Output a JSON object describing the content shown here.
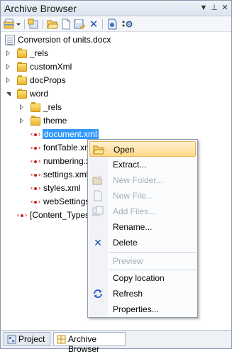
{
  "window": {
    "title": "Archive Browser",
    "buttons": {
      "dropdown": "▼",
      "pin": "⊥",
      "close": "✕"
    }
  },
  "toolbar": {
    "icons": [
      "new-archive-icon",
      "dropdown-arrow-icon",
      "add-icon",
      "open-folder-icon",
      "new-file-icon",
      "save-icon",
      "delete-icon",
      "document-icon",
      "settings-icon"
    ]
  },
  "tree": {
    "root": "Conversion of units.docx",
    "items": [
      {
        "label": "_rels",
        "type": "folder"
      },
      {
        "label": "customXml",
        "type": "folder"
      },
      {
        "label": "docProps",
        "type": "folder"
      },
      {
        "label": "word",
        "type": "folder"
      },
      {
        "label": "_rels",
        "type": "folder"
      },
      {
        "label": "theme",
        "type": "folder"
      },
      {
        "label": "document.xml",
        "type": "xml"
      },
      {
        "label": "fontTable.xml",
        "type": "xml"
      },
      {
        "label": "numbering.xml",
        "type": "xml"
      },
      {
        "label": "settings.xml",
        "type": "xml"
      },
      {
        "label": "styles.xml",
        "type": "xml"
      },
      {
        "label": "webSettings.xml",
        "type": "xml"
      },
      {
        "label": "[Content_Types].xml",
        "type": "xml"
      }
    ]
  },
  "context_menu": {
    "items": [
      {
        "label": "Open",
        "icon": "open-folder-icon",
        "enabled": true,
        "highlighted": true
      },
      {
        "label": "Extract...",
        "icon": "",
        "enabled": true
      },
      {
        "label": "New Folder...",
        "icon": "new-folder-icon",
        "enabled": false
      },
      {
        "label": "New File...",
        "icon": "new-file-icon",
        "enabled": false
      },
      {
        "label": "Add Files...",
        "icon": "add-files-icon",
        "enabled": false
      },
      {
        "label": "Rename...",
        "icon": "",
        "enabled": true
      },
      {
        "label": "Delete",
        "icon": "delete-icon",
        "enabled": true
      },
      {
        "label": "Preview",
        "icon": "",
        "enabled": false
      },
      {
        "label": "Copy location",
        "icon": "",
        "enabled": true
      },
      {
        "label": "Refresh",
        "icon": "refresh-icon",
        "enabled": true
      },
      {
        "label": "Properties...",
        "icon": "",
        "enabled": true
      }
    ]
  },
  "bottom_tabs": [
    {
      "label": "Project",
      "active": false
    },
    {
      "label": "Archive Browser",
      "active": true
    }
  ],
  "colors": {
    "selection": "#3399ff",
    "menu_highlight": "#ffd88a",
    "xml_icon": "#c8211b",
    "folder": "#e8b52d"
  }
}
